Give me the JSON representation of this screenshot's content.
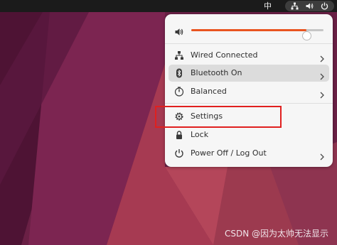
{
  "topbar": {
    "input_method": "中",
    "tray_icons": [
      "network-wired-icon",
      "volume-icon",
      "power-icon"
    ]
  },
  "menu": {
    "volume": {
      "icon": "volume-icon",
      "level": 0.87,
      "accent": "#e95420"
    },
    "items": [
      {
        "label": "Wired Connected",
        "icon": "network-wired-icon",
        "submenu": true,
        "active": false
      },
      {
        "label": "Bluetooth On",
        "icon": "bluetooth-icon",
        "submenu": true,
        "active": true
      },
      {
        "label": "Balanced",
        "icon": "power-profile-icon",
        "submenu": true,
        "active": false
      },
      {
        "label": "Settings",
        "icon": "gear-icon",
        "submenu": false,
        "active": false
      },
      {
        "label": "Lock",
        "icon": "lock-icon",
        "submenu": false,
        "active": false
      },
      {
        "label": "Power Off / Log Out",
        "icon": "power-icon",
        "submenu": true,
        "active": false
      }
    ]
  },
  "annotation": {
    "highlight_color": "#e0201f"
  },
  "watermark": "CSDN @因为太帅无法显示"
}
